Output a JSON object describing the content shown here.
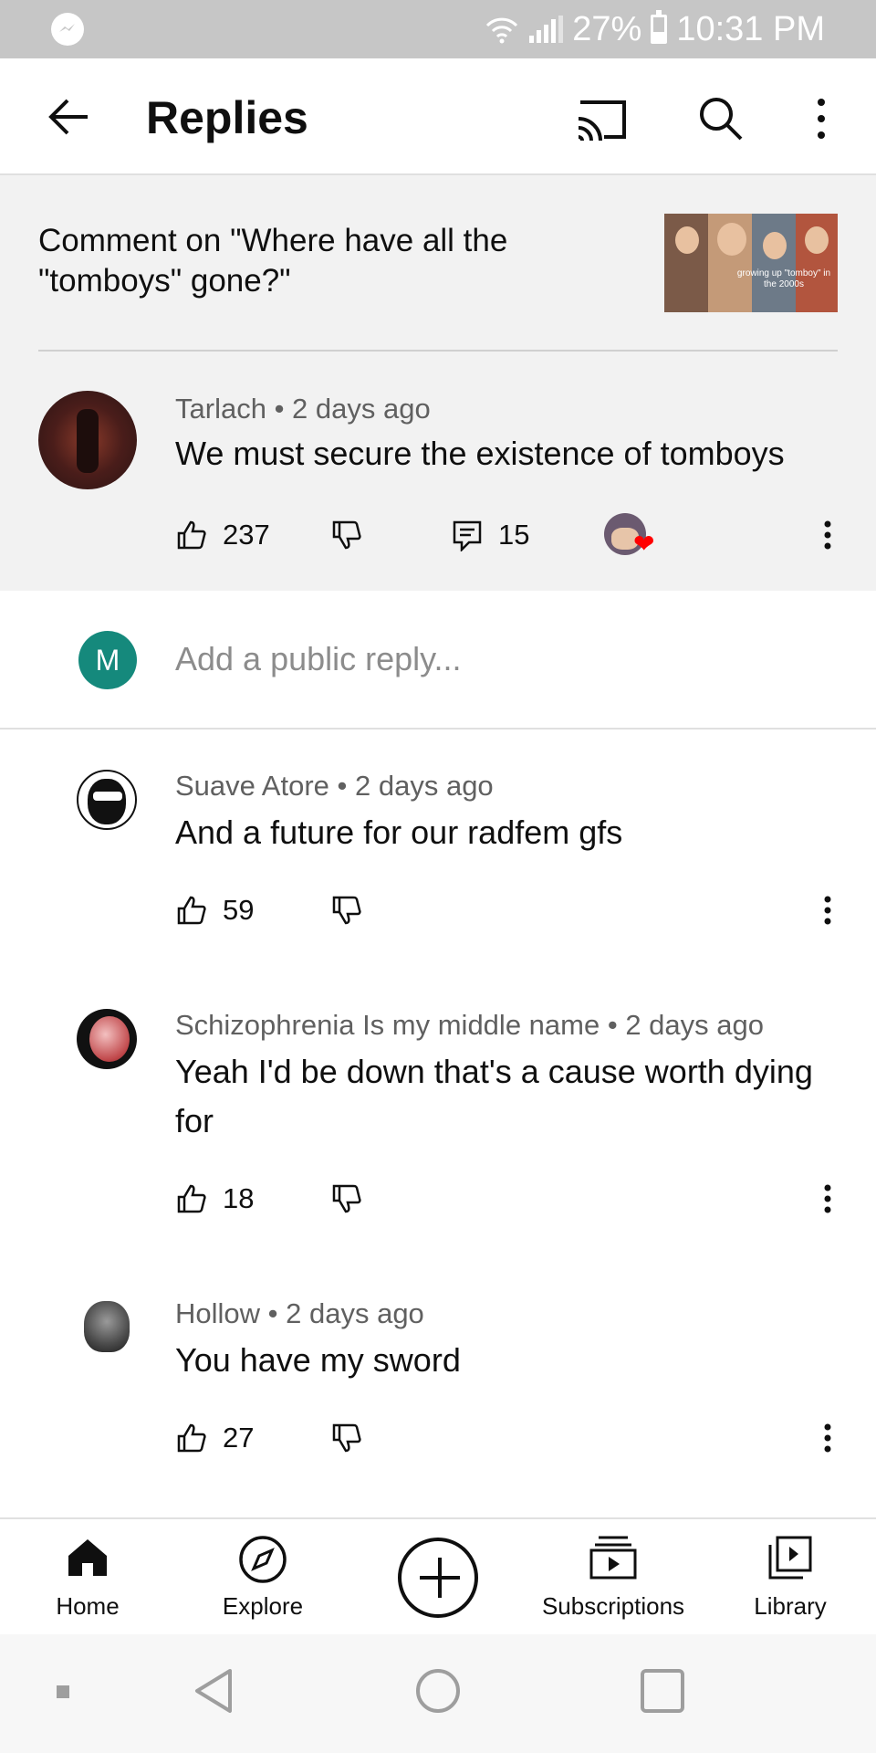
{
  "status_bar": {
    "battery": "27%",
    "time": "10:31 PM",
    "left_icon": "messenger-icon"
  },
  "app_bar": {
    "title": "Replies",
    "icons": [
      "back-arrow-icon",
      "cast-icon",
      "search-icon",
      "more-vertical-icon"
    ]
  },
  "context": {
    "title": "Comment on \"Where have all the \"tomboys\" gone?\"",
    "thumbnail_caption": "growing up \"tomboy\" in the 2000s"
  },
  "main_comment": {
    "author": "Tarlach",
    "time": "2 days ago",
    "text": "We must secure the existence of tomboys",
    "likes": "237",
    "replies": "15",
    "creator_heart": true
  },
  "reply_input": {
    "avatar_letter": "M",
    "placeholder": "Add a public reply..."
  },
  "replies": [
    {
      "author": "Suave Atore",
      "time": "2 days ago",
      "text": "And a future for our radfem gfs",
      "likes": "59"
    },
    {
      "author": "Schizophrenia Is my middle name",
      "time": "2 days ago",
      "text": "Yeah I'd be down that's a cause worth dying for",
      "likes": "18"
    },
    {
      "author": "Hollow",
      "time": "2 days ago",
      "text": "You have my sword",
      "likes": "27"
    }
  ],
  "bottom_nav": {
    "home": "Home",
    "explore": "Explore",
    "subscriptions": "Subscriptions",
    "library": "Library"
  },
  "colors": {
    "accent_red": "#ff0000",
    "my_avatar": "#15897c",
    "meta_gray": "#606060",
    "context_bg": "#f2f2f2"
  }
}
